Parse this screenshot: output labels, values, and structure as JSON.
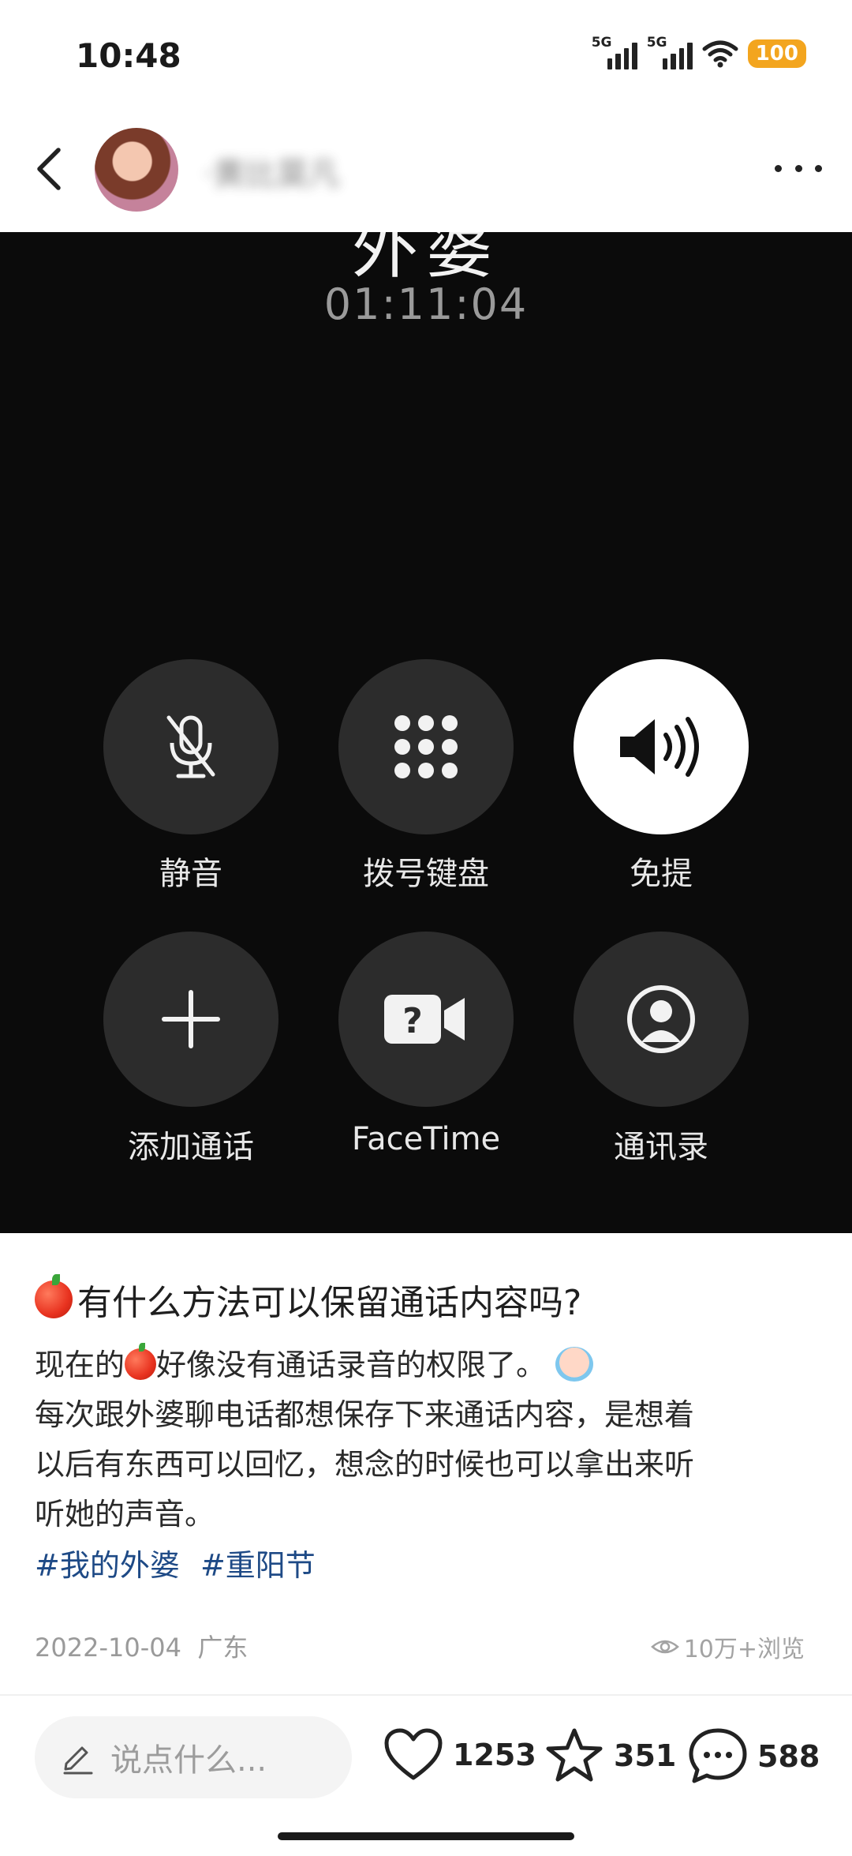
{
  "status": {
    "time": "10:48",
    "sim1": "5G",
    "sim2": "5G",
    "battery": "100"
  },
  "header": {
    "author": "·黄比莫凡"
  },
  "photo": {
    "contact_name": "外婆",
    "timer": "01:11:04",
    "buttons": [
      {
        "label": "静音",
        "icon": "mic-off-icon"
      },
      {
        "label": "拨号键盘",
        "icon": "keypad-icon"
      },
      {
        "label": "免提",
        "icon": "speaker-icon"
      },
      {
        "label": "添加通话",
        "icon": "plus-icon"
      },
      {
        "label": "FaceTime",
        "icon": "facetime-icon"
      },
      {
        "label": "通讯录",
        "icon": "contacts-icon"
      }
    ]
  },
  "post": {
    "title": "有什么方法可以保留通话内容吗?",
    "line1_a": "现在的",
    "line1_b": "好像没有通话录音的权限了。",
    "line2": "每次跟外婆聊电话都想保存下来通话内容，是想着",
    "line3": "以后有东西可以回忆，想念的时候也可以拿出来听",
    "line4": "听她的声音。",
    "tags": [
      "#我的外婆",
      "#重阳节"
    ],
    "date": "2022-10-04",
    "location": "广东",
    "views": "10万+浏览"
  },
  "bottom": {
    "comment_placeholder": "说点什么...",
    "likes": "1253",
    "favorites": "351",
    "comments": "588"
  }
}
